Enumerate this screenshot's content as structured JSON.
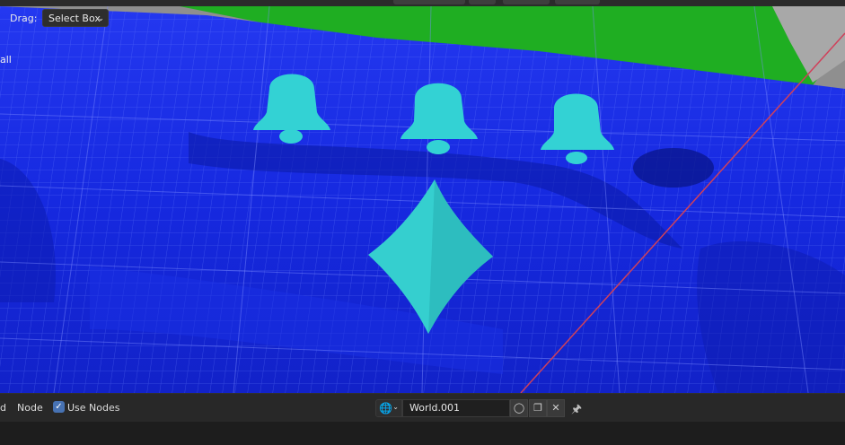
{
  "header": {
    "drag_label": "Drag:",
    "drag_mode": "Select Box",
    "side_text": "all"
  },
  "footer": {
    "left_fragment": "d",
    "node_label": "Node",
    "use_nodes_label": "Use Nodes",
    "use_nodes_checked": true,
    "world_name": "World.001"
  },
  "colors": {
    "mesh": "#1a2ee8",
    "emblem": "#33d2d4",
    "grass": "#22b024",
    "checkbox": "#4772b3"
  },
  "icons": {
    "world": "globe-icon",
    "fake_user": "shield-icon",
    "duplicate": "duplicate-icon",
    "unlink": "close-icon",
    "pin": "pin-icon",
    "emblems": [
      "bell-icon",
      "bell-icon",
      "bell-icon",
      "diamond-icon"
    ]
  }
}
